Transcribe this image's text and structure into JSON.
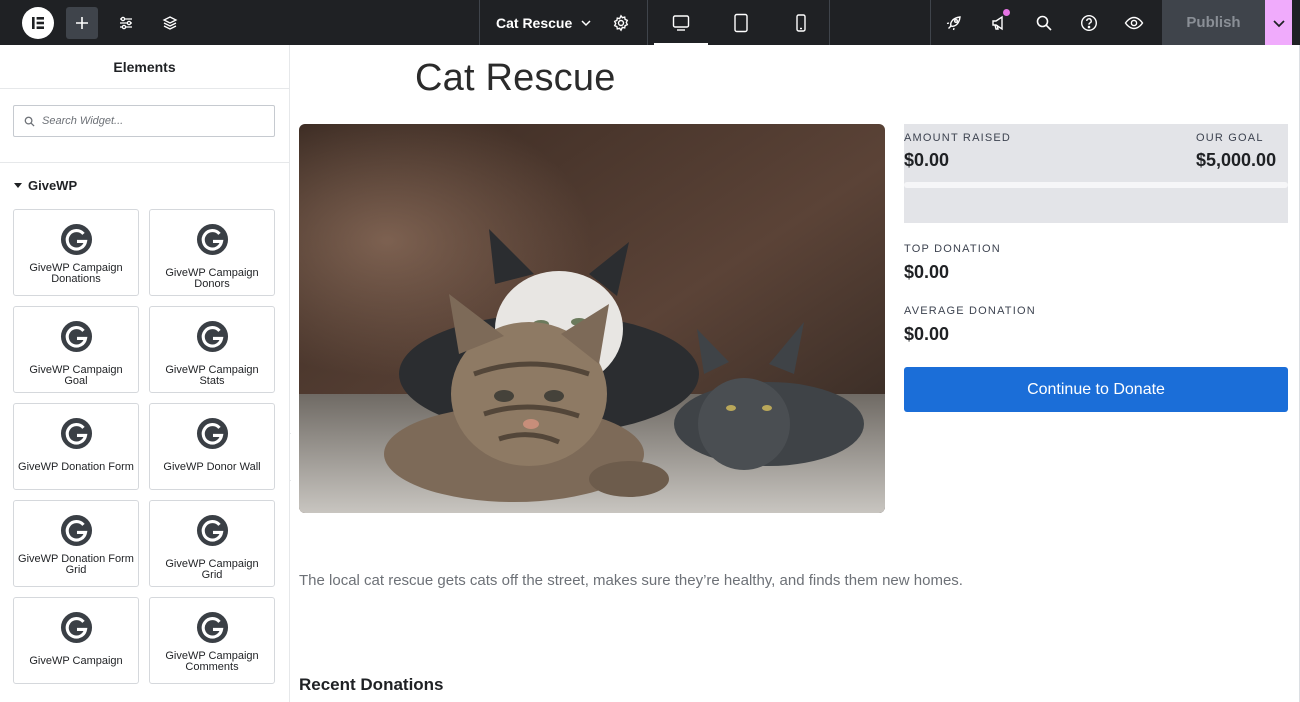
{
  "topbar": {
    "logo_icon": "elementor-logo-icon",
    "add_icon": "plus-icon",
    "settings_icon": "sliders-icon",
    "structure_icon": "layers-icon",
    "document_title": "Cat Rescue",
    "device_modes": [
      "desktop",
      "tablet",
      "mobile"
    ],
    "active_device": "desktop",
    "right_icons": [
      "rocket-icon",
      "announcement-icon",
      "search-icon",
      "help-icon",
      "preview-eye-icon"
    ],
    "publish_label": "Publish",
    "accent_color": "#f0abfc"
  },
  "panel": {
    "title": "Elements",
    "search_placeholder": "Search Widget...",
    "category": "GiveWP",
    "widgets": [
      {
        "label": "GiveWP Campaign Donations"
      },
      {
        "label": "GiveWP Campaign Donors"
      },
      {
        "label": "GiveWP Campaign Goal"
      },
      {
        "label": "GiveWP Campaign Stats"
      },
      {
        "label": "GiveWP Donation Form"
      },
      {
        "label": "GiveWP Donor Wall"
      },
      {
        "label": "GiveWP Donation Form Grid"
      },
      {
        "label": "GiveWP Campaign Grid"
      },
      {
        "label": "GiveWP Campaign"
      },
      {
        "label": "GiveWP Campaign Comments"
      }
    ]
  },
  "page": {
    "title": "Cat Rescue",
    "goal": {
      "raised_label": "AMOUNT RAISED",
      "raised_value": "$0.00",
      "goal_label": "OUR GOAL",
      "goal_value": "$5,000.00",
      "progress_fraction": 0
    },
    "top_donation_label": "TOP DONATION",
    "top_donation_value": "$0.00",
    "average_donation_label": "AVERAGE DONATION",
    "average_donation_value": "$0.00",
    "donate_button": "Continue to Donate",
    "button_color": "#1b6ed8",
    "description": "The local cat rescue gets cats off the street, makes sure they’re healthy, and finds them new homes.",
    "recent_heading": "Recent Donations"
  }
}
